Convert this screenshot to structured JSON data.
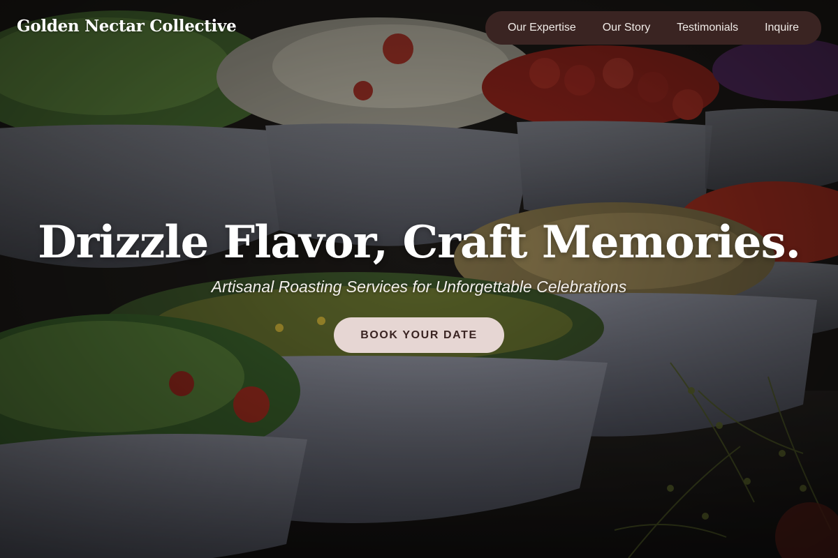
{
  "header": {
    "brand": "Golden Nectar Collective",
    "nav": [
      {
        "label": "Our Expertise"
      },
      {
        "label": "Our Story"
      },
      {
        "label": "Testimonials"
      },
      {
        "label": "Inquire"
      }
    ]
  },
  "hero": {
    "title": "Drizzle Flavor, Craft Memories.",
    "subtitle": "Artisanal Roasting Services for Unforgettable Celebrations",
    "cta_label": "BOOK YOUR DATE",
    "background": "salad-bowls-buffet-photo"
  },
  "colors": {
    "nav_pill": "#3a2422",
    "cta_background": "#e6d6d3",
    "cta_text": "#3a2422",
    "text_primary": "#ffffff"
  }
}
